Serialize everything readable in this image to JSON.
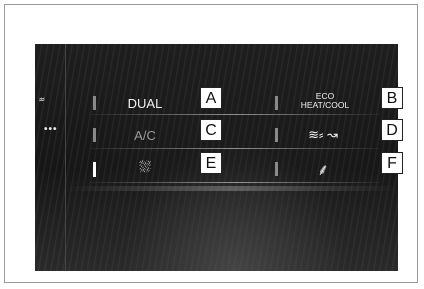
{
  "buttons": {
    "dual": {
      "label": "DUAL",
      "tag": "A"
    },
    "eco": {
      "line1": "ECO",
      "line2": "HEAT/COOL",
      "tag": "B"
    },
    "ac": {
      "label": "A/C",
      "tag": "C"
    },
    "airflow": {
      "icon": "≋⸗ ↝",
      "tag": "D"
    },
    "defrost": {
      "icon": "⛆",
      "tag": "E"
    },
    "seat": {
      "icon": "⸙",
      "tag": "F"
    }
  },
  "sidebar": {
    "climate_icon": "⸗⸗",
    "more": "•••"
  }
}
